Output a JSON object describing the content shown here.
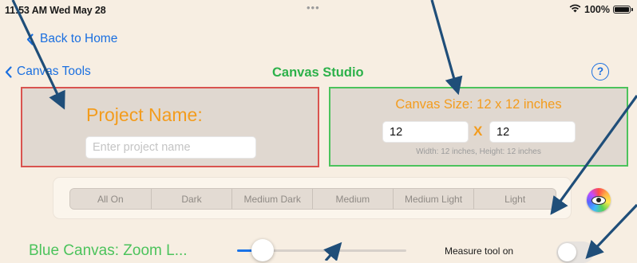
{
  "status_bar": {
    "time": "11:53 AM  Wed May 28",
    "dots": "•••",
    "battery_text": "100%",
    "icons": [
      "wifi-icon",
      "battery-icon"
    ]
  },
  "nav": {
    "back_home": "Back to Home",
    "back_tools": "Canvas Tools",
    "title": "Canvas Studio",
    "help": "?"
  },
  "project": {
    "label": "Project Name:",
    "placeholder": "Enter project name",
    "value": ""
  },
  "canvas_size": {
    "title": "Canvas Size: 12 x 12 inches",
    "width_value": "12",
    "height_value": "12",
    "times": "X",
    "caption": "Width: 12 inches, Height: 12 inches"
  },
  "segments": [
    "All On",
    "Dark",
    "Medium Dark",
    "Medium",
    "Medium Light",
    "Light"
  ],
  "zoom": {
    "label": "Blue Canvas: Zoom L...",
    "level": 0.08
  },
  "measure": {
    "label": "Measure tool on",
    "enabled": false
  },
  "colors": {
    "background": "#f7eee2",
    "accent_blue": "#1a6fe0",
    "title_green": "#2cb14a",
    "label_orange": "#f39c1d",
    "project_border": "#d9534f",
    "canvas_border": "#4cc35c",
    "arrow": "#1f4e79"
  }
}
